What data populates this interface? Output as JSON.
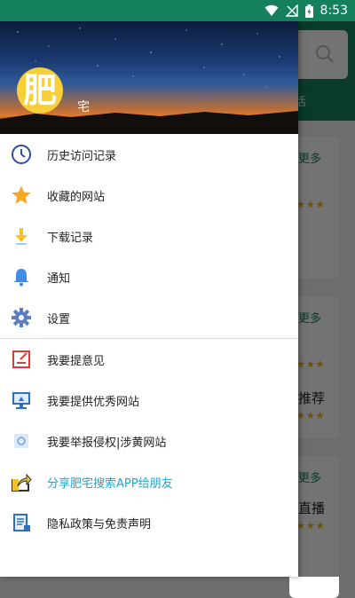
{
  "status_bar": {
    "time": "8:53"
  },
  "drawer": {
    "header": {
      "avatar_char": "肥",
      "username": "宅"
    },
    "group1": [
      {
        "name": "history",
        "label": "历史访问记录",
        "icon": "clock-icon"
      },
      {
        "name": "favorites",
        "label": "收藏的网站",
        "icon": "star-icon"
      },
      {
        "name": "downloads",
        "label": "下载记录",
        "icon": "download-icon"
      },
      {
        "name": "notifications",
        "label": "通知",
        "icon": "bell-icon"
      },
      {
        "name": "settings",
        "label": "设置",
        "icon": "gear-icon"
      }
    ],
    "group2": [
      {
        "name": "feedback",
        "label": "我要提意见",
        "icon": "feedback-icon"
      },
      {
        "name": "submit-site",
        "label": "我要提供优秀网站",
        "icon": "monitor-icon"
      },
      {
        "name": "report",
        "label": "我要举报侵权|涉黄网站",
        "icon": "report-icon"
      },
      {
        "name": "share",
        "label": "分享肥宅搜索APP给朋友",
        "icon": "share-icon"
      },
      {
        "name": "privacy",
        "label": "隐私政策与免责声明",
        "icon": "document-icon"
      }
    ]
  },
  "background_app": {
    "tab_partial": "活",
    "cards": [
      {
        "more": "更多",
        "word": ""
      },
      {
        "more": "更多",
        "word": "推荐"
      },
      {
        "more": "更多",
        "word": "直播"
      }
    ]
  },
  "colors": {
    "primary": "#14805e",
    "accent_text": "#1aa8cf",
    "avatar_bg": "#f7cf3a"
  }
}
